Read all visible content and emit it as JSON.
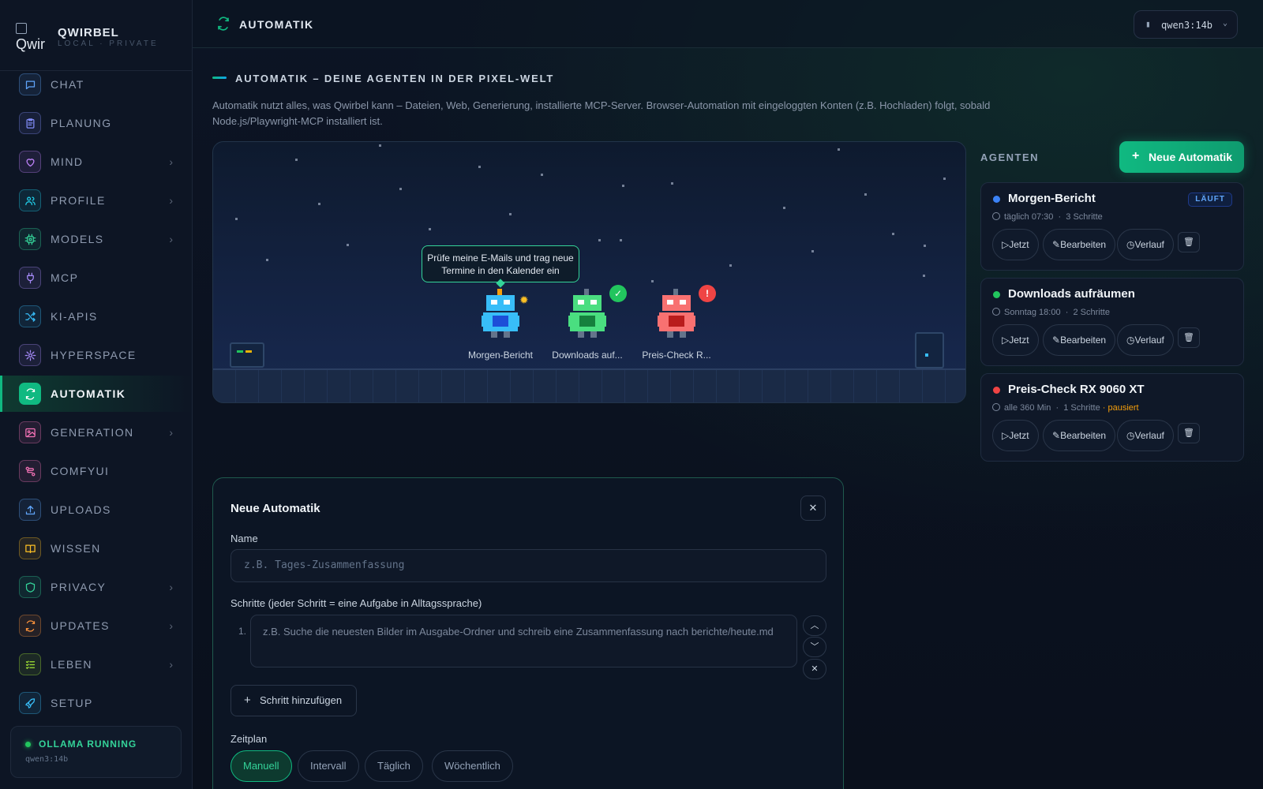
{
  "brand": {
    "logo_text": "Qwir",
    "title": "QWIRBEL",
    "subtitle": "LOCAL · PRIVATE"
  },
  "sidebar": {
    "items": [
      {
        "label": "CHAT",
        "icon": "chat-icon",
        "color": "#60a5fa",
        "chevron": false,
        "active": false
      },
      {
        "label": "PLANUNG",
        "icon": "clipboard-icon",
        "color": "#818cf8",
        "chevron": false,
        "active": false
      },
      {
        "label": "MIND",
        "icon": "heart-icon",
        "color": "#c084fc",
        "chevron": true,
        "active": false
      },
      {
        "label": "PROFILE",
        "icon": "users-icon",
        "color": "#22d3ee",
        "chevron": true,
        "active": false
      },
      {
        "label": "MODELS",
        "icon": "chip-icon",
        "color": "#34d399",
        "chevron": true,
        "active": false
      },
      {
        "label": "MCP",
        "icon": "plug-icon",
        "color": "#a78bfa",
        "chevron": false,
        "active": false
      },
      {
        "label": "KI-APIS",
        "icon": "shuffle-icon",
        "color": "#38bdf8",
        "chevron": false,
        "active": false
      },
      {
        "label": "HYPERSPACE",
        "icon": "spark-icon",
        "color": "#a78bfa",
        "chevron": false,
        "active": false
      },
      {
        "label": "AUTOMATIK",
        "icon": "refresh-icon",
        "color": "#10b981",
        "chevron": false,
        "active": true
      },
      {
        "label": "GENERATION",
        "icon": "image-icon",
        "color": "#f472b6",
        "chevron": true,
        "active": false
      },
      {
        "label": "COMFYUI",
        "icon": "workflow-icon",
        "color": "#f472b6",
        "chevron": false,
        "active": false
      },
      {
        "label": "UPLOADS",
        "icon": "upload-icon",
        "color": "#60a5fa",
        "chevron": false,
        "active": false
      },
      {
        "label": "WISSEN",
        "icon": "book-icon",
        "color": "#fbbf24",
        "chevron": false,
        "active": false
      },
      {
        "label": "PRIVACY",
        "icon": "shield-icon",
        "color": "#34d399",
        "chevron": true,
        "active": false
      },
      {
        "label": "UPDATES",
        "icon": "refresh-icon",
        "color": "#fb923c",
        "chevron": true,
        "active": false
      },
      {
        "label": "LEBEN",
        "icon": "checklist-icon",
        "color": "#a3e635",
        "chevron": true,
        "active": false
      },
      {
        "label": "SETUP",
        "icon": "rocket-icon",
        "color": "#38bdf8",
        "chevron": false,
        "active": false
      }
    ]
  },
  "status": {
    "label": "OLLAMA RUNNING",
    "model": "qwen3:14b"
  },
  "header": {
    "title": "AUTOMATIK",
    "model_selector": "qwen3:14b"
  },
  "main": {
    "section_title": "AUTOMATIK – DEINE AGENTEN IN DER PIXEL-WELT",
    "description": "Automatik nutzt alles, was Qwirbel kann – Dateien, Web, Generierung, installierte MCP-Server. Browser-Automation mit eingeloggten Konten (z.B. Hochladen) folgt, sobald Node.js/Playwright-MCP installiert ist."
  },
  "world": {
    "tooltip": "Prüfe meine E-Mails und trag neue Termine in den Kalender ein",
    "bots": [
      {
        "label": "Morgen-Bericht",
        "color": "#38bdf8",
        "dark": "#1d4ed8",
        "state": "working"
      },
      {
        "label": "Downloads auf...",
        "color": "#4ade80",
        "dark": "#15803d",
        "state": "done"
      },
      {
        "label": "Preis-Check R...",
        "color": "#f87171",
        "dark": "#b91c1c",
        "state": "error"
      }
    ]
  },
  "agents": {
    "title": "AGENTEN",
    "new_button": "Neue Automatik",
    "list": [
      {
        "name": "Morgen-Bericht",
        "dot": "#3b82f6",
        "schedule": "täglich 07:30",
        "steps": "3 Schritte",
        "badge": "LÄUFT",
        "paused": ""
      },
      {
        "name": "Downloads aufräumen",
        "dot": "#22c55e",
        "schedule": "Sonntag 18:00",
        "steps": "2 Schritte",
        "badge": "",
        "paused": ""
      },
      {
        "name": "Preis-Check RX 9060 XT",
        "dot": "#ef4444",
        "schedule": "alle 360 Min",
        "steps": "1 Schritte",
        "badge": "",
        "paused": "· pausiert"
      }
    ],
    "buttons": {
      "run": "Jetzt",
      "edit": "Bearbeiten",
      "history": "Verlauf"
    }
  },
  "form": {
    "title": "Neue Automatik",
    "name_label": "Name",
    "name_placeholder": "z.B. Tages-Zusammenfassung",
    "steps_label": "Schritte (jeder Schritt = eine Aufgabe in Alltagssprache)",
    "step_number": "1.",
    "step_placeholder": "z.B. Suche die neuesten Bilder im Ausgabe-Ordner und schreib eine Zusammenfassung nach berichte/heute.md",
    "add_step": "Schritt hinzufügen",
    "schedule_label": "Zeitplan",
    "schedule_options": [
      "Manuell",
      "Intervall",
      "Täglich",
      "Wöchentlich"
    ],
    "schedule_selected": "Manuell"
  }
}
